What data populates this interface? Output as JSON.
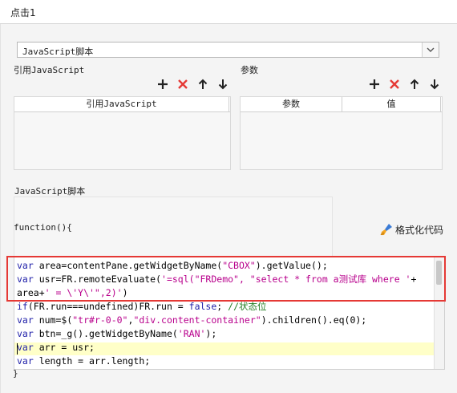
{
  "window": {
    "title": "点击1"
  },
  "script_type": {
    "selected": "JavaScript脚本"
  },
  "refs": {
    "label": "引用JavaScript",
    "column": "引用JavaScript"
  },
  "params": {
    "label": "参数",
    "columns": [
      "参数",
      "值"
    ]
  },
  "toolbar_icons": [
    "add-icon",
    "delete-icon",
    "move-up-icon",
    "move-down-icon"
  ],
  "editor": {
    "section_label": "JavaScript脚本",
    "function_header": "function(){",
    "format_button": "格式化代码",
    "code_lines": [
      [
        [
          "kw",
          "var "
        ],
        [
          "t",
          "area=contentPane.getWidgetByName("
        ],
        [
          "str",
          "\"CBOX\""
        ],
        [
          "t",
          ").getValue();"
        ]
      ],
      [
        [
          "kw",
          "var "
        ],
        [
          "t",
          "usr=FR.remoteEvaluate("
        ],
        [
          "str",
          "'=sql(\"FRDemo\", \"select * from a测试库 where '"
        ],
        [
          "t",
          "+"
        ]
      ],
      [
        [
          "t",
          "area+"
        ],
        [
          "str",
          "' = \\'Y\\'\",2)'"
        ],
        [
          "t",
          ")"
        ]
      ],
      [
        [
          "kw",
          "if"
        ],
        [
          "t",
          "(FR.run===undefined)FR.run = "
        ],
        [
          "kw",
          "false"
        ],
        [
          "t",
          "; "
        ],
        [
          "cmt",
          "//状态位"
        ]
      ],
      [
        [
          "kw",
          "var "
        ],
        [
          "t",
          "num=$("
        ],
        [
          "str",
          "\"tr#r-0-0\""
        ],
        [
          "t",
          ","
        ],
        [
          "str",
          "\"div.content-container\""
        ],
        [
          "t",
          ").children().eq(0);"
        ]
      ],
      [
        [
          "kw",
          "var "
        ],
        [
          "t",
          "btn=_g().getWidgetByName("
        ],
        [
          "str",
          "'RAN'"
        ],
        [
          "t",
          ");"
        ]
      ],
      [
        [
          "kw",
          "var "
        ],
        [
          "t",
          "arr = usr;"
        ]
      ],
      [
        [
          "kw",
          "var "
        ],
        [
          "t",
          "length = arr.length;"
        ]
      ]
    ],
    "closing": "}"
  },
  "colors": {
    "keyword": "#1e1ea8",
    "string": "#b8008c",
    "comment": "#268026",
    "highlight_line": "#ffffc8",
    "annotation_box": "#e53935"
  }
}
